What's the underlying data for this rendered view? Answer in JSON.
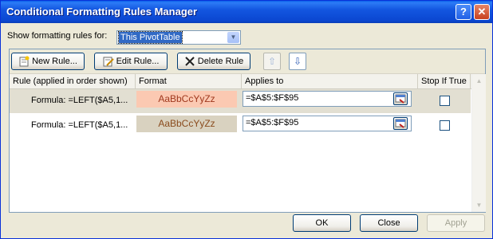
{
  "window": {
    "title": "Conditional Formatting Rules Manager",
    "help_glyph": "?",
    "close_glyph": "✕"
  },
  "filter": {
    "label": "Show formatting rules for:",
    "selected": "This PivotTable"
  },
  "toolbar": {
    "new_rule": "New Rule...",
    "edit_rule": "Edit Rule...",
    "delete_rule": "Delete Rule",
    "move_up_glyph": "⇧",
    "move_down_glyph": "⇩"
  },
  "columns": {
    "rule": "Rule (applied in order shown)",
    "format": "Format",
    "applies_to": "Applies to",
    "stop_if_true": "Stop If True"
  },
  "rules": [
    {
      "formula": "Formula: =LEFT($A5,1...",
      "format_preview": "AaBbCcYyZz",
      "format_bg": "#FBC9B2",
      "format_fg": "#A0391E",
      "applies_to": "=$A$5:$F$95",
      "stop_if_true": false
    },
    {
      "formula": "Formula: =LEFT($A5,1...",
      "format_preview": "AaBbCcYyZz",
      "format_bg": "#D9D2C0",
      "format_fg": "#8A4B1D",
      "applies_to": "=$A$5:$F$95",
      "stop_if_true": false
    }
  ],
  "buttons": {
    "ok": "OK",
    "close": "Close",
    "apply": "Apply"
  },
  "colors": {
    "title_bar": "#0B47D1",
    "dialog_bg": "#ECE9D8",
    "selection": "#316AC5"
  }
}
